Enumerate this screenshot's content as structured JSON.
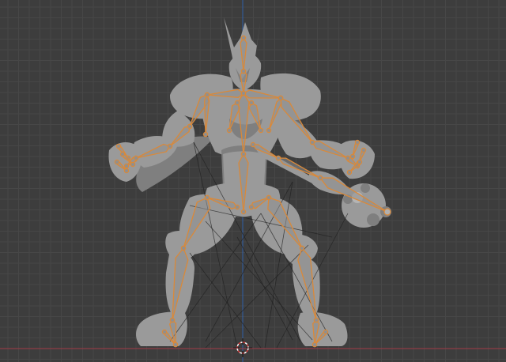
{
  "viewport": {
    "background": "#3d3d3d",
    "grid_minor_color": "#474747",
    "grid_major_color": "#505050",
    "x_axis_color": "#a33a47",
    "z_axis_color": "#2f5fa8"
  },
  "model": {
    "body_color": "#9a9a9a",
    "shadow_color": "#7f7f7f",
    "highlight_color": "#b4b4b4"
  },
  "armature": {
    "bone_color": "#d9893a",
    "bone_fill": "#8f8f8f",
    "ik_line_color": "#1f1f1f"
  },
  "icons": {
    "cursor": "3d-cursor-icon"
  }
}
